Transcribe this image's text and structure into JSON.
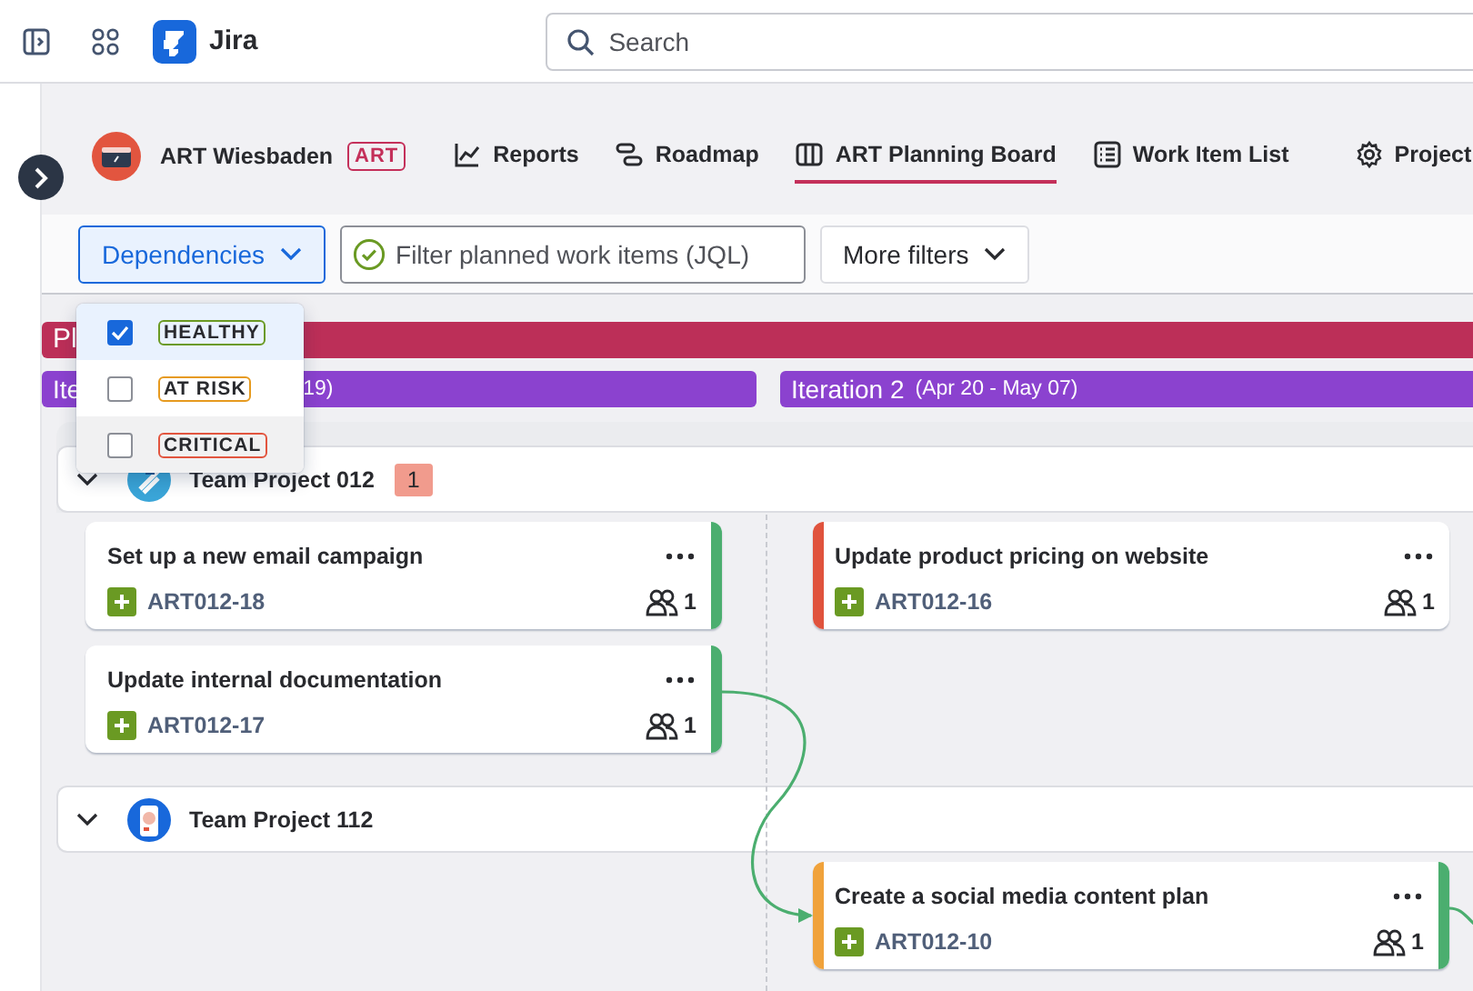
{
  "topbar": {
    "product": "Jira",
    "search": {
      "placeholder": "Search"
    }
  },
  "project": {
    "name": "ART Wiesbaden",
    "badge": "ART"
  },
  "nav": [
    {
      "label": "Reports",
      "kind": "chart",
      "selected": false
    },
    {
      "label": "Roadmap",
      "kind": "roadmap",
      "selected": false
    },
    {
      "label": "ART Planning Board",
      "kind": "board",
      "selected": true
    },
    {
      "label": "Work Item List",
      "kind": "list",
      "selected": false
    },
    {
      "label": "Project",
      "kind": "gear",
      "selected": false
    }
  ],
  "filters": {
    "dependencies": {
      "label": "Dependencies",
      "expanded": true,
      "options": [
        {
          "label": "HEALTHY",
          "checked": true,
          "hovered": false,
          "color": "#6a9a23"
        },
        {
          "label": "AT RISK",
          "checked": false,
          "hovered": false,
          "color": "#e69a1f"
        },
        {
          "label": "CRITICAL",
          "checked": false,
          "hovered": true,
          "color": "#e2553f"
        }
      ]
    },
    "jql": {
      "placeholder": "Filter planned work items (JQL)"
    },
    "more": "More filters"
  },
  "pi_bar": {
    "label": "Pl"
  },
  "iterations": [
    {
      "label": "Ite",
      "dates": "19)"
    },
    {
      "label": "Iteration 2",
      "dates": "(Apr 20 - May 07)"
    }
  ],
  "lanes": [
    {
      "name": "Team Project 012",
      "count": "1",
      "expanded": true,
      "cards": [
        {
          "title": "Set up a new email campaign",
          "key": "ART012-18",
          "assignees": "1",
          "second_iteration": false,
          "end_edge": {
            "color": "#4bae6f"
          },
          "outgoing_link": false,
          "incoming_link": false
        },
        {
          "title": "Update product pricing on website",
          "key": "ART012-16",
          "assignees": "1",
          "second_iteration": true,
          "start_edge": {
            "color": "#e0533d"
          },
          "outgoing_link": false,
          "incoming_link": false
        },
        {
          "title": "Update internal documentation",
          "key": "ART012-17",
          "assignees": "1",
          "second_iteration": false,
          "end_edge": {
            "color": "#4bae6f"
          },
          "outgoing_link": true,
          "incoming_link": false
        }
      ]
    },
    {
      "name": "Team Project 112",
      "expanded": true,
      "cards": [
        {
          "title": "Create a social media content plan",
          "key": "ART012-10",
          "assignees": "1",
          "second_iteration": true,
          "start_edge": {
            "color": "#f0a23b"
          },
          "end_edge": {
            "color": "#4bae6f"
          },
          "outgoing_link": true,
          "incoming_link": true
        }
      ]
    }
  ]
}
